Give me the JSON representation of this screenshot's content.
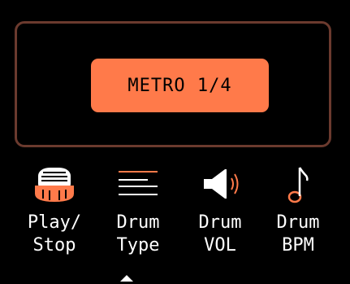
{
  "display": {
    "mode_label": "METRO 1/4"
  },
  "colors": {
    "accent": "#ff7a4a",
    "frame": "#6b3a2e",
    "text": "#ffffff",
    "background": "#000000"
  },
  "bottom_bar": {
    "items": [
      {
        "icon": "drum-icon",
        "line1": "Play/",
        "line2": "Stop"
      },
      {
        "icon": "lines-icon",
        "line1": "Drum",
        "line2": "Type"
      },
      {
        "icon": "speaker-icon",
        "line1": "Drum",
        "line2": "VOL"
      },
      {
        "icon": "note-icon",
        "line1": "Drum",
        "line2": "BPM"
      }
    ],
    "selected_index": 1
  }
}
